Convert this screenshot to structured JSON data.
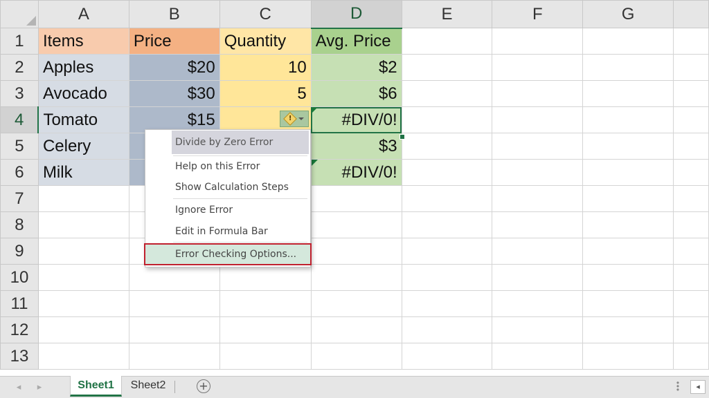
{
  "columns": [
    "A",
    "B",
    "C",
    "D",
    "E",
    "F",
    "G"
  ],
  "rows": [
    "1",
    "2",
    "3",
    "4",
    "5",
    "6",
    "7",
    "8",
    "9",
    "10",
    "11",
    "12",
    "13"
  ],
  "cells": {
    "A1": "Items",
    "B1": "Price",
    "C1": "Quantity",
    "D1": "Avg. Price",
    "A2": "Apples",
    "B2": "$20",
    "C2": "10",
    "D2": "$2",
    "A3": "Avocado",
    "B3": "$30",
    "C3": "5",
    "D3": "$6",
    "A4": "Tomato",
    "B4": "$15",
    "C4": "",
    "D4": "#DIV/0!",
    "A5": "Celery",
    "B5": "",
    "C5": "",
    "D5": "$3",
    "A6": "Milk",
    "B6": "",
    "C6": "",
    "D6": "#DIV/0!"
  },
  "error_button": {
    "icon": "warning-diamond-icon",
    "glyph": "!"
  },
  "context_menu": {
    "title": "Divide by Zero Error",
    "items": [
      "Help on this Error",
      "Show Calculation Steps",
      "Ignore Error",
      "Edit in Formula Bar",
      "Error Checking Options..."
    ]
  },
  "sheet_tabs": [
    "Sheet1",
    "Sheet2"
  ],
  "add_sheet_glyph": "+",
  "colors": {
    "accent": "#217346",
    "highlight_outline": "#c0202e",
    "header_items": "#f8cbad",
    "header_price": "#f4b183",
    "header_quantity": "#ffe6a6",
    "header_avg_price": "#a9d18e"
  }
}
